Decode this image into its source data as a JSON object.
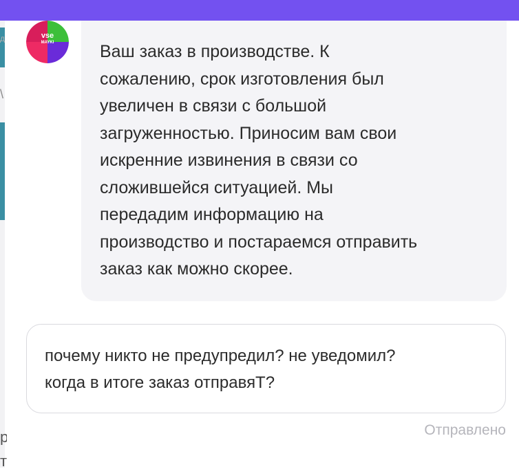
{
  "header": {
    "accent_color": "#7351f0"
  },
  "sidebar": {
    "glyphs": [
      "д",
      "\\",
      "р",
      "т"
    ]
  },
  "incoming_message": {
    "avatar": {
      "line1": "vse",
      "line2": "MAYKI"
    },
    "text": "Ваш заказ в производстве. К\nсожалению, срок изготовления был\nувеличен в связи с большой\nзагруженностью. Приносим вам свои\nискренние извинения в связи со\nсложившейся ситуацией. Мы\nпередадим информацию на\nпроизводство и постараемся отправить\nзаказ как можно скорее."
  },
  "outgoing_message": {
    "text": "почему никто не предупредил? не уведомил?\nкогда в итоге заказ отправяТ?",
    "status": "Отправлено"
  }
}
